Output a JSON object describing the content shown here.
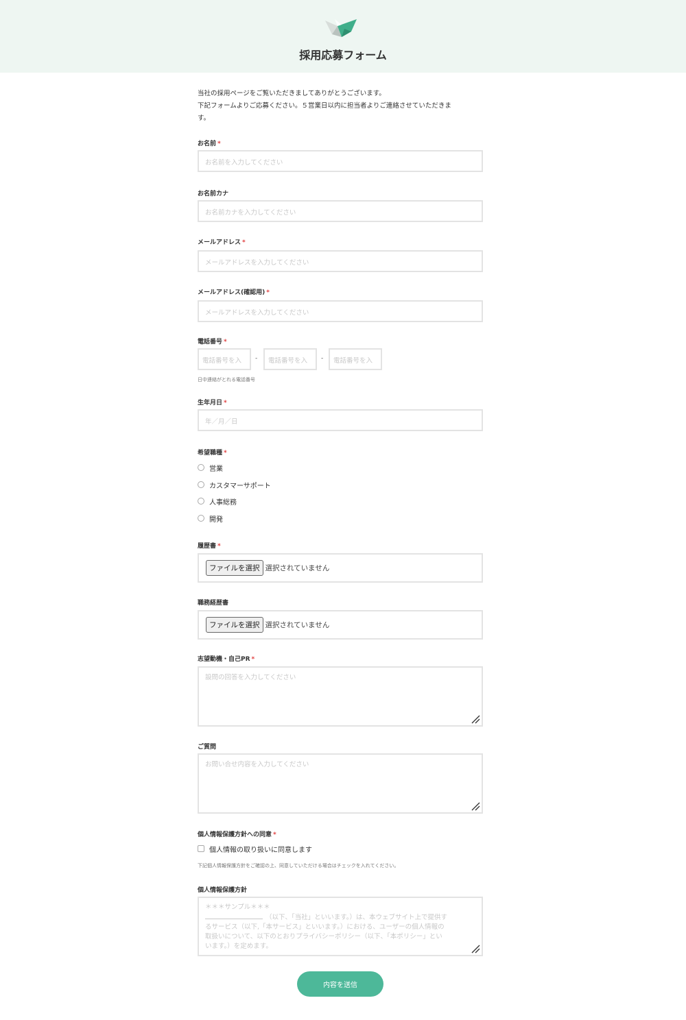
{
  "header": {
    "title": "採用応募フォーム",
    "logo_icon": "paper-crane-logo",
    "background": "#eef6f2"
  },
  "intro": {
    "line1": "当社の採用ページをご覧いただきましてありがとうございます。",
    "line2": "下記フォームよりご応募ください。５営業日以内に担当者よりご連絡させていただきま",
    "line3": "す。"
  },
  "required_mark": "*",
  "fields": {
    "name": {
      "label": "お名前",
      "required": true,
      "placeholder": "お名前を入力してください"
    },
    "name_kana": {
      "label": "お名前カナ",
      "required": false,
      "placeholder": "お名前カナを入力してください"
    },
    "email": {
      "label": "メールアドレス",
      "required": true,
      "placeholder": "メールアドレスを入力してください"
    },
    "email_confirm": {
      "label": "メールアドレス(確認用)",
      "required": true,
      "placeholder": "メールアドレスを入力してください"
    },
    "phone": {
      "label": "電話番号",
      "required": true,
      "placeholder": "電話番号を入",
      "separator": "-",
      "help": "日中連絡がとれる電話番号"
    },
    "birthdate": {
      "label": "生年月日",
      "required": true,
      "placeholder": "年／月／日"
    },
    "position": {
      "label": "希望職種",
      "required": true,
      "options": [
        "営業",
        "カスタマーサポート",
        "人事総務",
        "開発"
      ]
    },
    "resume": {
      "label": "履歴書",
      "required": true,
      "button": "ファイルを選択",
      "status": "選択されていません"
    },
    "cv": {
      "label": "職務経歴書",
      "required": false,
      "button": "ファイルを選択",
      "status": "選択されていません"
    },
    "motivation": {
      "label": "志望動機・自己PR",
      "required": true,
      "placeholder": "設問の回答を入力してください"
    },
    "question": {
      "label": "ご質問",
      "required": false,
      "placeholder": "お問い合せ内容を入力してください"
    },
    "consent": {
      "label": "個人情報保護方針への同意",
      "required": true,
      "checkbox_label": "個人情報の取り扱いに同意します",
      "help": "下記個人情報保護方針をご確認の上、同意していただける場合はチェックを入れてください。"
    },
    "policy": {
      "label": "個人情報保護方針",
      "line1": "＊＊＊サンプル＊＊＊",
      "line2": "（以下、「当社」といいます。）は、本ウェブサイト上で提供す",
      "line3": "るサービス（以下,「本サービス」といいます。）における、ユーザーの個人情報の",
      "line4": "取扱いについて、以下のとおりプライバシーポリシー（以下、「本ポリシー」とい",
      "line5": "います。）を定めます。"
    }
  },
  "submit": {
    "label": "内容を送信"
  },
  "colors": {
    "accent": "#4db899",
    "required": "#e04040",
    "border": "#e3e3e3"
  }
}
